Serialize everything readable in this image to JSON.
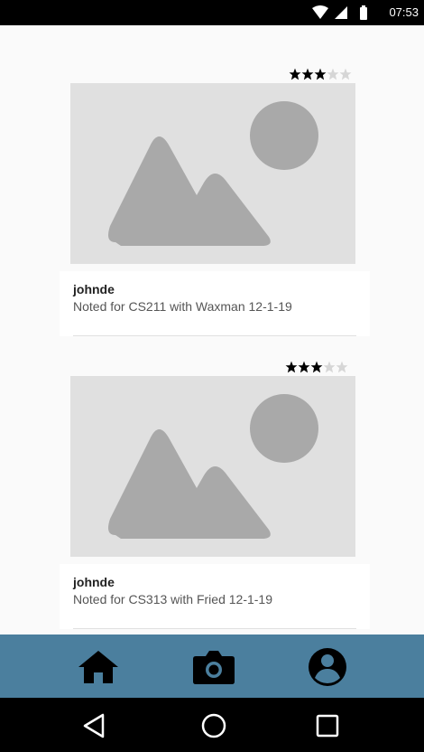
{
  "status_bar": {
    "time": "07:53"
  },
  "posts": [
    {
      "username": "johnde",
      "description": "Noted for CS211 with Waxman 12-1-19",
      "rating": 3,
      "rating_max": 5
    },
    {
      "username": "johnde",
      "description": "Noted for CS313 with Fried 12-1-19",
      "rating": 3,
      "rating_max": 5
    }
  ],
  "bottom_nav": {
    "items": [
      {
        "icon": "home-icon"
      },
      {
        "icon": "camera-icon"
      },
      {
        "icon": "account-icon"
      }
    ]
  },
  "system_nav": {
    "items": [
      {
        "icon": "back-icon"
      },
      {
        "icon": "home-circle-icon"
      },
      {
        "icon": "recents-icon"
      }
    ]
  },
  "colors": {
    "nav_bar": "#4b7f9e",
    "placeholder_bg": "#e0e0e0",
    "placeholder_shape": "#a9a9a9"
  }
}
